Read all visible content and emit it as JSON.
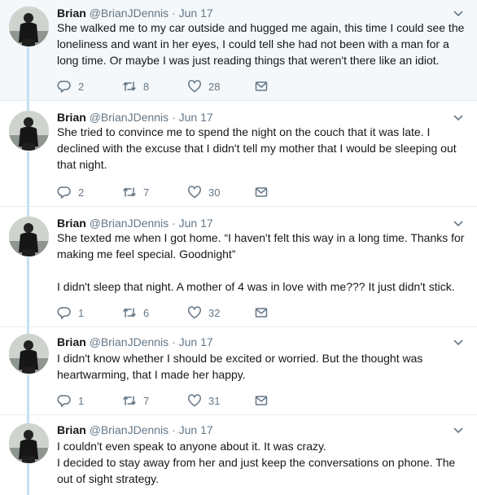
{
  "colors": {
    "rail": "#c4e1f2",
    "icon": "#657786",
    "highlight_bg": "#f5f8fa"
  },
  "icons": {
    "reply": "reply-icon",
    "retweet": "retweet-icon",
    "like": "heart-icon",
    "dm": "envelope-icon",
    "more": "chevron-down-icon"
  },
  "tweets": [
    {
      "name": "Brian",
      "handle": "@BrianJDennis",
      "sep": "·",
      "time": "Jun 17",
      "text": [
        "She walked me to my car outside and hugged me again, this time I could see the loneliness and want in her eyes, I could tell she had not been with a man for a long time. Or maybe I was just reading things that weren't there like an idiot."
      ],
      "replies": "2",
      "retweets": "8",
      "likes": "28"
    },
    {
      "name": "Brian",
      "handle": "@BrianJDennis",
      "sep": "·",
      "time": "Jun 17",
      "text": [
        "She tried to convince me to spend the night on the couch that it was late. I declined with the excuse that I didn't tell my mother that I would be sleeping out that night."
      ],
      "replies": "2",
      "retweets": "7",
      "likes": "30"
    },
    {
      "name": "Brian",
      "handle": "@BrianJDennis",
      "sep": "·",
      "time": "Jun 17",
      "text": [
        "She texted me when I got home. “I haven't felt this way in a long time. Thanks for making me feel special. Goodnight”",
        "I didn't sleep that night. A mother of 4 was in love with me??? It just didn't stick."
      ],
      "replies": "1",
      "retweets": "6",
      "likes": "32"
    },
    {
      "name": "Brian",
      "handle": "@BrianJDennis",
      "sep": "·",
      "time": "Jun 17",
      "text": [
        "I didn't know whether I should be excited or worried. But the thought was heartwarming, that I made her happy."
      ],
      "replies": "1",
      "retweets": "7",
      "likes": "31"
    },
    {
      "name": "Brian",
      "handle": "@BrianJDennis",
      "sep": "·",
      "time": "Jun 17",
      "text": [
        "I couldn't even speak to anyone about it. It was crazy.",
        "I decided to stay away from her and just keep the conversations on phone. The out of sight strategy."
      ],
      "replies": "",
      "retweets": "",
      "likes": ""
    }
  ]
}
